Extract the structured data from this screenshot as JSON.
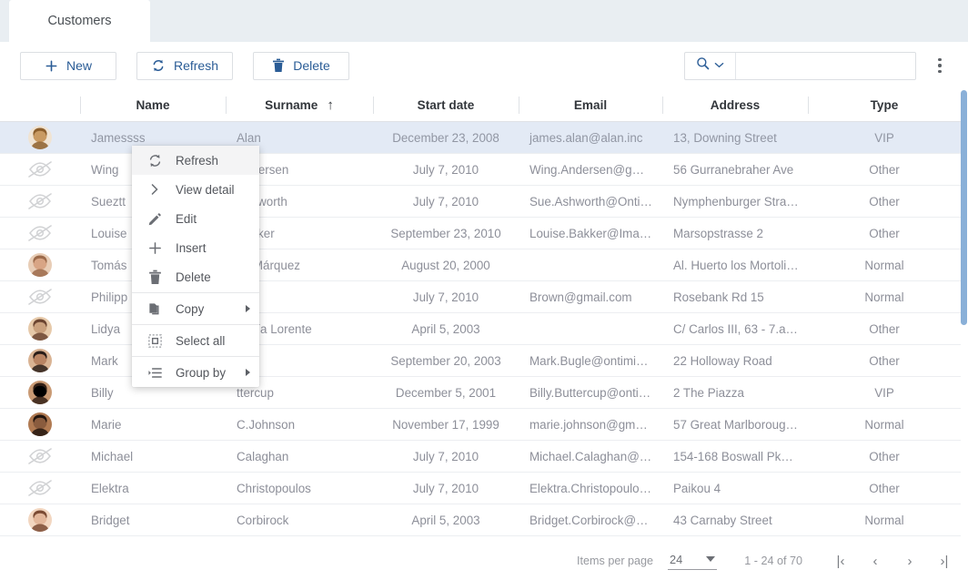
{
  "tabs": [
    {
      "label": "Customers",
      "active": true
    }
  ],
  "toolbar": {
    "new_label": "New",
    "refresh_label": "Refresh",
    "delete_label": "Delete",
    "search_value": "",
    "search_placeholder": "",
    "icons": {
      "new": "plus-icon",
      "refresh": "refresh-icon",
      "delete": "trash-icon",
      "search": "search-icon",
      "chevron": "chevron-down-icon",
      "overflow": "kebab-menu-icon"
    }
  },
  "grid": {
    "columns": [
      {
        "key": "avatar",
        "label": "",
        "align": "center"
      },
      {
        "key": "name",
        "label": "Name",
        "align": "center",
        "sort": ""
      },
      {
        "key": "surname",
        "label": "Surname",
        "align": "center",
        "sort": "asc"
      },
      {
        "key": "startdate",
        "label": "Start date",
        "align": "center",
        "sort": ""
      },
      {
        "key": "email",
        "label": "Email",
        "align": "center",
        "sort": ""
      },
      {
        "key": "address",
        "label": "Address",
        "align": "center",
        "sort": ""
      },
      {
        "key": "type",
        "label": "Type",
        "align": "center",
        "sort": ""
      }
    ],
    "sort_indicator": "↑",
    "rows": [
      {
        "avatar": "photo-dog",
        "name": "Jamessss",
        "surname": "Alan",
        "startdate": "December 23, 2008",
        "email": "james.alan@alan.inc",
        "address": "13, Downing Street",
        "type": "VIP",
        "selected": true
      },
      {
        "avatar": "no-image",
        "name": "Wing",
        "surname": "Andersen",
        "startdate": "July 7, 2010",
        "email": "Wing.Andersen@gm…",
        "address": "56 Gurranebraher Ave",
        "type": "Other",
        "selected": false
      },
      {
        "avatar": "no-image",
        "name": "Sueztt",
        "surname": "Ashworth",
        "startdate": "July 7, 2010",
        "email": "Sue.Ashworth@Onti…",
        "address": "Nymphenburger Stra…",
        "type": "Other",
        "selected": false
      },
      {
        "avatar": "no-image",
        "name": "Louise",
        "surname": "Bakker",
        "startdate": "September 23, 2010",
        "email": "Louise.Bakker@Imati…",
        "address": "Marsopstrasse 2",
        "type": "Other",
        "selected": false
      },
      {
        "avatar": "photo-man-1",
        "name": "Tomás",
        "surname": "os Márquez",
        "startdate": "August 20, 2000",
        "email": "",
        "address": "Al. Huerto los Mortolit…",
        "type": "Normal",
        "selected": false
      },
      {
        "avatar": "no-image",
        "name": "Philipp",
        "surname": "wn",
        "startdate": "July 7, 2010",
        "email": "Brown@gmail.com",
        "address": "Rosebank Rd 15",
        "type": "Normal",
        "selected": false
      },
      {
        "avatar": "photo-woman-1",
        "name": "Lidya",
        "surname": "endía Lorente",
        "startdate": "April 5, 2003",
        "email": "",
        "address": "C/ Carlos III, 63 - 7.a …",
        "type": "Other",
        "selected": false
      },
      {
        "avatar": "photo-man-2",
        "name": "Mark",
        "surname": "gle",
        "startdate": "September 20, 2003",
        "email": "Mark.Bugle@ontimiz…",
        "address": "22 Holloway Road",
        "type": "Other",
        "selected": false
      },
      {
        "avatar": "photo-man-3",
        "name": "Billy",
        "surname": "ttercup",
        "startdate": "December 5, 2001",
        "email": "Billy.Buttercup@onti…",
        "address": "2 The Piazza",
        "type": "VIP",
        "selected": false
      },
      {
        "avatar": "photo-woman-2",
        "name": "Marie",
        "surname": "C.Johnson",
        "startdate": "November 17, 1999",
        "email": "marie.johnson@gma…",
        "address": "57 Great Marlboroug…",
        "type": "Normal",
        "selected": false
      },
      {
        "avatar": "no-image",
        "name": "Michael",
        "surname": "Calaghan",
        "startdate": "July 7, 2010",
        "email": "Michael.Calaghan@…",
        "address": "154-168 Boswall Pkwy…",
        "type": "Other",
        "selected": false
      },
      {
        "avatar": "no-image",
        "name": "Elektra",
        "surname": "Christopoulos",
        "startdate": "July 7, 2010",
        "email": "Elektra.Christopoulos…",
        "address": "Paikou 4",
        "type": "Other",
        "selected": false
      },
      {
        "avatar": "photo-woman-3",
        "name": "Bridget",
        "surname": "Corbirock",
        "startdate": "April 5, 2003",
        "email": "Bridget.Corbirock@y…",
        "address": "43 Carnaby Street",
        "type": "Normal",
        "selected": false
      }
    ]
  },
  "context_menu": {
    "items": [
      {
        "label": "Refresh",
        "icon": "refresh-icon",
        "submenu": false,
        "hover": true,
        "separator_after": false
      },
      {
        "label": "View detail",
        "icon": "chevron-right-icon",
        "submenu": false,
        "hover": false,
        "separator_after": false
      },
      {
        "label": "Edit",
        "icon": "pencil-icon",
        "submenu": false,
        "hover": false,
        "separator_after": false
      },
      {
        "label": "Insert",
        "icon": "plus-icon",
        "submenu": false,
        "hover": false,
        "separator_after": false
      },
      {
        "label": "Delete",
        "icon": "trash-icon",
        "submenu": false,
        "hover": false,
        "separator_after": true
      },
      {
        "label": "Copy",
        "icon": "copy-icon",
        "submenu": true,
        "hover": false,
        "separator_after": true
      },
      {
        "label": "Select all",
        "icon": "select-all-icon",
        "submenu": false,
        "hover": false,
        "separator_after": true
      },
      {
        "label": "Group by",
        "icon": "group-by-icon",
        "submenu": true,
        "hover": false,
        "separator_after": false
      }
    ]
  },
  "footer": {
    "items_per_page_label": "Items per page",
    "items_per_page_value": "24",
    "range_label": "1 - 24 of 70",
    "pager": [
      {
        "name": "first-page-button",
        "glyph": "|‹"
      },
      {
        "name": "prev-page-button",
        "glyph": "‹"
      },
      {
        "name": "next-page-button",
        "glyph": "›"
      },
      {
        "name": "last-page-button",
        "glyph": "›|"
      }
    ]
  },
  "colors": {
    "accent": "#2a5c96",
    "selected_row": "#e3eaf5",
    "tabbar": "#e9eef2",
    "scrollbar": "#8ab0d8"
  }
}
